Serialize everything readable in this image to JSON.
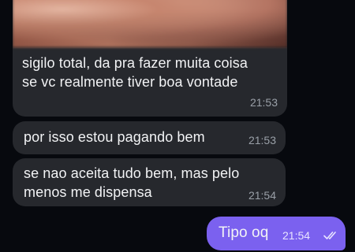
{
  "messages": [
    {
      "direction": "incoming",
      "has_media": true,
      "text": "sigilo total, da pra fazer muita coisa\nse vc realmente tiver boa vontade",
      "time": "21:53"
    },
    {
      "direction": "incoming",
      "text": "por isso estou pagando bem",
      "time": "21:53"
    },
    {
      "direction": "incoming",
      "text": "se nao aceita tudo bem, mas pelo\nmenos me dispensa",
      "time": "21:54"
    },
    {
      "direction": "outgoing",
      "text": "Tipo oq",
      "time": "21:54",
      "status_icon": "double-check-icon"
    }
  ],
  "colors": {
    "background": "#07090e",
    "incoming_bubble": "#26282d",
    "outgoing_bubble": "#7b61ef"
  }
}
